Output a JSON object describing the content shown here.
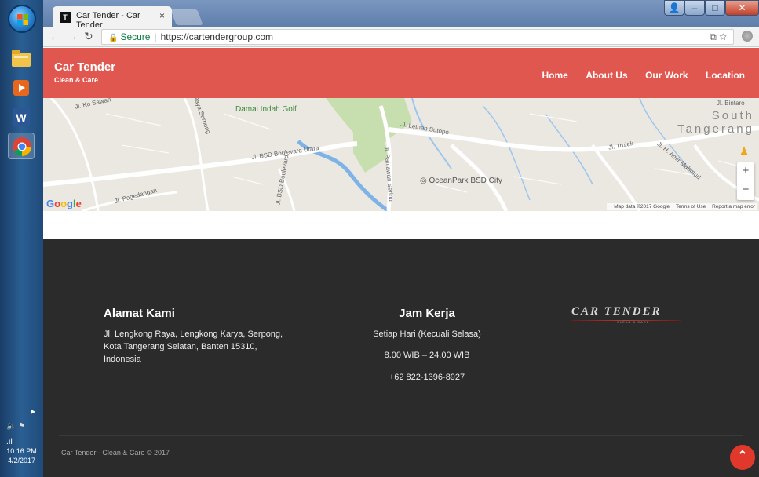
{
  "taskbar": {
    "clock_time": "10:16 PM",
    "clock_date": "4/2/2017"
  },
  "browser": {
    "tab_title": "Car Tender - Car Tender",
    "secure_label": "Secure",
    "url": "https://cartendergroup.com"
  },
  "site": {
    "brand_title": "Car Tender",
    "brand_subtitle": "Clean & Care",
    "nav": [
      "Home",
      "About Us",
      "Our Work",
      "Location"
    ],
    "accent_color": "#e0574f"
  },
  "map": {
    "labels": {
      "jl_ko_sawah": "Jl. Ko Sawah",
      "damai_indah": "Damai Indah Golf",
      "letnan_sutopo": "Jl. Letnan Sutopo",
      "bsd_boulevard_utara": "Jl. BSD Boulevard Utara",
      "bsd_boulevard": "Jl. BSD Boulevard",
      "oceanpark": "OceanPark BSD City",
      "south_tangerang_1": "South",
      "south_tangerang_2": "Tangerang",
      "raya_utara": "Jl. Raya Serpong",
      "pagedangan": "Jl. Pagedangan",
      "truiek": "Jl. Truiek",
      "amir_mahmud": "Jl. H. Amir Mahmud",
      "bintaro": "Jl. Bintaro",
      "pahlawan_seribu": "Jl. Pahlawan Seribu"
    },
    "footer_data": "Map data ©2017 Google",
    "footer_terms": "Terms of Use",
    "footer_report": "Report a map error"
  },
  "footer": {
    "address_title": "Alamat Kami",
    "address_line1": "Jl. Lengkong Raya, Lengkong Karya, Serpong,",
    "address_line2": "Kota Tangerang Selatan, Banten 15310,",
    "address_line3": "Indonesia",
    "hours_title": "Jam Kerja",
    "hours_days": "Setiap Hari (Kecuali Selasa)",
    "hours_time": "8.00 WIB – 24.00 WIB",
    "phone": "+62 822-1396-8927",
    "logo_text": "CAR TENDER",
    "logo_sub": "CLEAN & CARE",
    "copyright": "Car Tender - Clean & Care © 2017"
  }
}
